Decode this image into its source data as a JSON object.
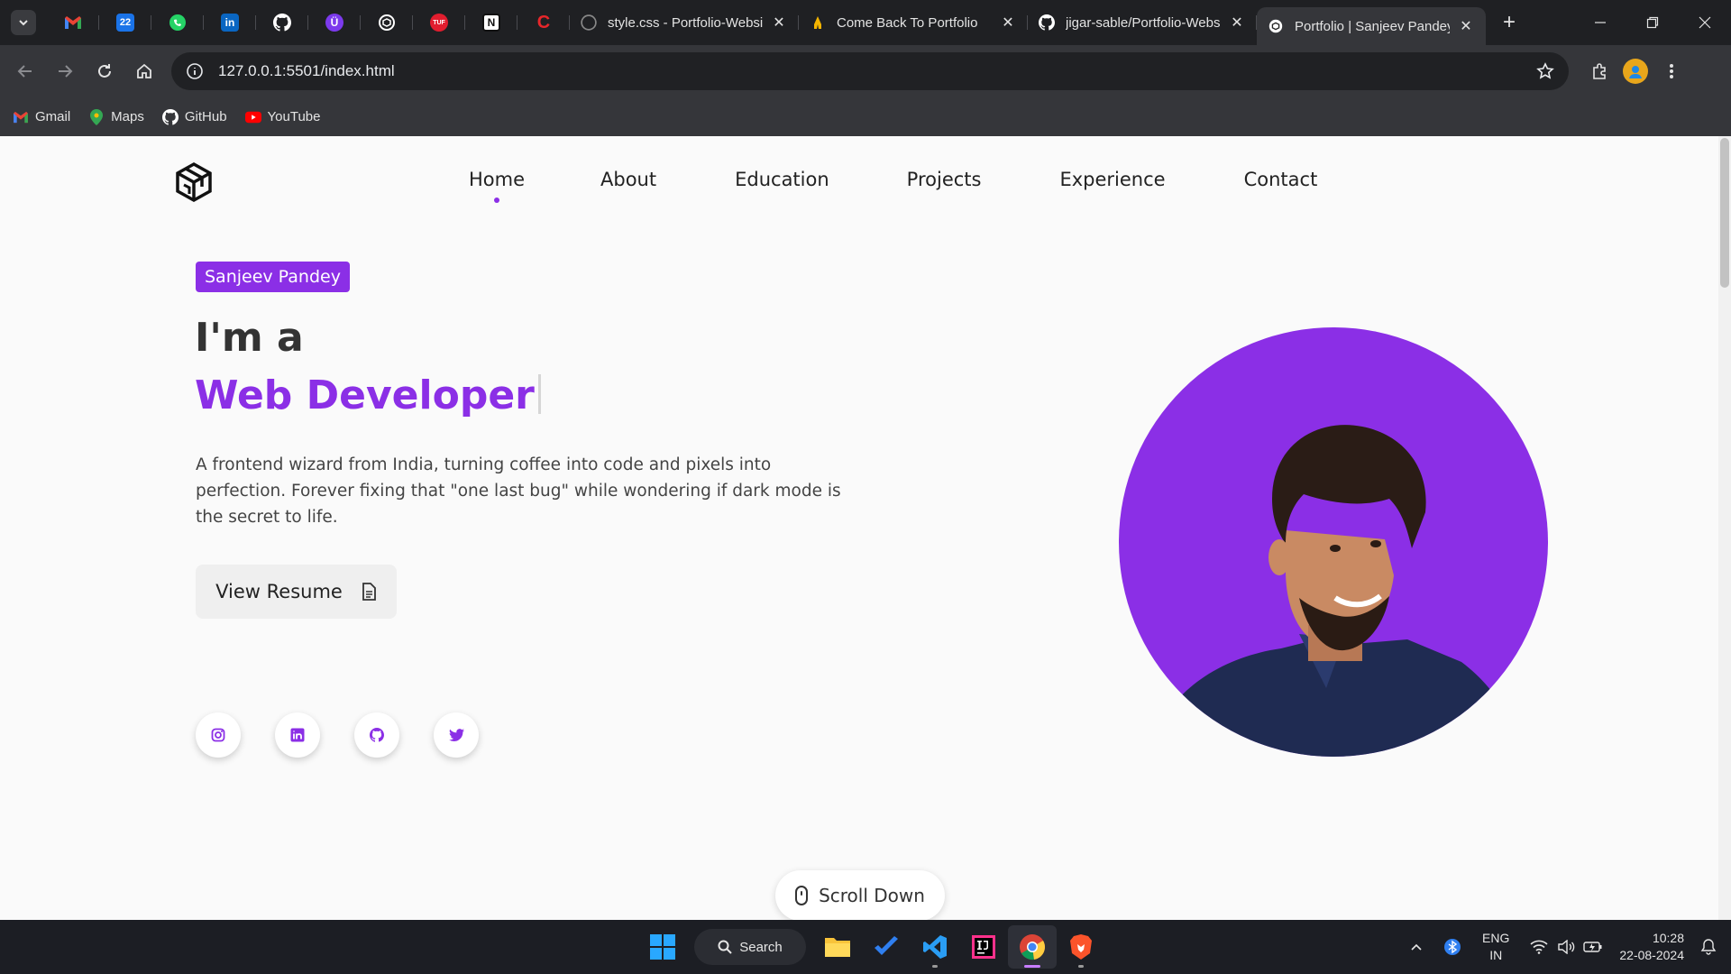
{
  "browser": {
    "pinned_tabs": [
      {
        "icon": "gmail-icon",
        "color": "#ea4335"
      },
      {
        "icon": "calendar-icon",
        "label": "22",
        "color": "#1a73e8"
      },
      {
        "icon": "whatsapp-icon",
        "color": "#25d366"
      },
      {
        "icon": "linkedin-icon",
        "label": "in",
        "color": "#0a66c2"
      },
      {
        "icon": "github-icon",
        "color": "#ffffff"
      },
      {
        "icon": "app-icon",
        "label": "Ü",
        "color": "#7c3aed"
      },
      {
        "icon": "chatgpt-icon",
        "color": "#ffffff"
      },
      {
        "icon": "tuf-icon",
        "label": "TUF",
        "color": "#e11d2e"
      },
      {
        "icon": "notion-icon",
        "label": "N",
        "color": "#ffffff"
      },
      {
        "icon": "codechef-icon",
        "label": "C",
        "color": "#e8262a"
      }
    ],
    "tabs": [
      {
        "title": "style.css - Portfolio-Website",
        "icon": "github-icon"
      },
      {
        "title": "Come Back To Portfolio",
        "icon": "pray-icon"
      },
      {
        "title": "jigar-sable/Portfolio-Website",
        "icon": "github-icon"
      },
      {
        "title": "Portfolio | Sanjeev Pandey",
        "icon": "chatgpt-icon",
        "active": true
      }
    ],
    "url": "127.0.0.1:5501/index.html",
    "bookmarks": [
      {
        "label": "Gmail",
        "icon": "gmail-icon"
      },
      {
        "label": "Maps",
        "icon": "maps-icon"
      },
      {
        "label": "GitHub",
        "icon": "github-icon"
      },
      {
        "label": "YouTube",
        "icon": "youtube-icon"
      }
    ]
  },
  "page": {
    "nav": [
      "Home",
      "About",
      "Education",
      "Projects",
      "Experience",
      "Contact"
    ],
    "active_nav": "Home",
    "badge": "Sanjeev Pandey",
    "greeting": "I'm a",
    "role": "Web Developer",
    "bio": "A frontend wizard from India, turning coffee into code and pixels into perfection. Forever fixing that \"one last bug\" while wondering if dark mode is the secret to life.",
    "resume_button": "View Resume",
    "socials": [
      "instagram-icon",
      "linkedin-icon",
      "github-icon",
      "twitter-icon"
    ],
    "scroll_down": "Scroll Down",
    "accent": "#8b2fe6"
  },
  "taskbar": {
    "search": "Search",
    "lang_line1": "ENG",
    "lang_line2": "IN",
    "time": "10:28",
    "date": "22-08-2024"
  }
}
